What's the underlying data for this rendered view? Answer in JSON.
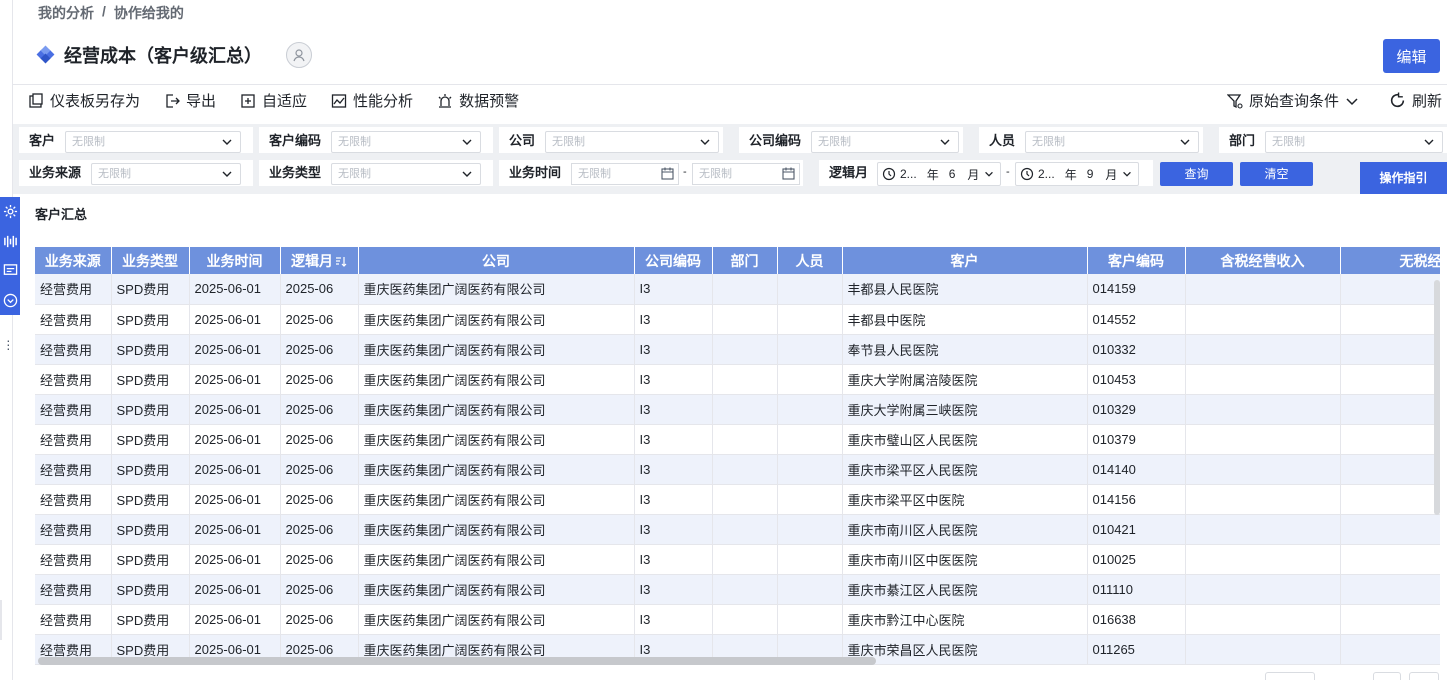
{
  "breadcrumb": {
    "home": "我的分析",
    "sep": "/",
    "current": "协作给我的"
  },
  "header": {
    "title": "经营成本（客户级汇总）",
    "edit_label": "编辑"
  },
  "toolbar": {
    "save_as": "仪表板另存为",
    "export": "导出",
    "adapt": "自适应",
    "perf": "性能分析",
    "alert": "数据预警",
    "orig_query": "原始查询条件",
    "refresh": "刷新"
  },
  "filters": {
    "placeholder": "无限制",
    "customer": "客户",
    "customer_code": "客户编码",
    "company": "公司",
    "company_code": "公司编码",
    "staff": "人员",
    "dept": "部门",
    "biz_source": "业务来源",
    "biz_type": "业务类型",
    "biz_time": "业务时间",
    "logic_month": "逻辑月",
    "dash": "-",
    "month_from": {
      "year": "2...",
      "year_unit": "年",
      "month": "6",
      "month_unit": "月"
    },
    "month_to": {
      "year": "2...",
      "year_unit": "年",
      "month": "9",
      "month_unit": "月"
    },
    "query": "查询",
    "clear": "清空",
    "op_guide": "操作指引"
  },
  "section": {
    "title": "客户汇总"
  },
  "table": {
    "columns": [
      "业务来源",
      "业务类型",
      "业务时间",
      "逻辑月",
      "公司",
      "公司编码",
      "部门",
      "人员",
      "客户",
      "客户编码",
      "含税经营收入",
      "无税经营"
    ],
    "rows": [
      [
        "经营费用",
        "SPD费用",
        "2025-06-01",
        "2025-06",
        "重庆医药集团广阔医药有限公司",
        "I3",
        "",
        "",
        "丰都县人民医院",
        "014159",
        "",
        ""
      ],
      [
        "经营费用",
        "SPD费用",
        "2025-06-01",
        "2025-06",
        "重庆医药集团广阔医药有限公司",
        "I3",
        "",
        "",
        "丰都县中医院",
        "014552",
        "",
        ""
      ],
      [
        "经营费用",
        "SPD费用",
        "2025-06-01",
        "2025-06",
        "重庆医药集团广阔医药有限公司",
        "I3",
        "",
        "",
        "奉节县人民医院",
        "010332",
        "",
        ""
      ],
      [
        "经营费用",
        "SPD费用",
        "2025-06-01",
        "2025-06",
        "重庆医药集团广阔医药有限公司",
        "I3",
        "",
        "",
        "重庆大学附属涪陵医院",
        "010453",
        "",
        ""
      ],
      [
        "经营费用",
        "SPD费用",
        "2025-06-01",
        "2025-06",
        "重庆医药集团广阔医药有限公司",
        "I3",
        "",
        "",
        "重庆大学附属三峡医院",
        "010329",
        "",
        ""
      ],
      [
        "经营费用",
        "SPD费用",
        "2025-06-01",
        "2025-06",
        "重庆医药集团广阔医药有限公司",
        "I3",
        "",
        "",
        "重庆市璧山区人民医院",
        "010379",
        "",
        ""
      ],
      [
        "经营费用",
        "SPD费用",
        "2025-06-01",
        "2025-06",
        "重庆医药集团广阔医药有限公司",
        "I3",
        "",
        "",
        "重庆市梁平区人民医院",
        "014140",
        "",
        ""
      ],
      [
        "经营费用",
        "SPD费用",
        "2025-06-01",
        "2025-06",
        "重庆医药集团广阔医药有限公司",
        "I3",
        "",
        "",
        "重庆市梁平区中医院",
        "014156",
        "",
        ""
      ],
      [
        "经营费用",
        "SPD费用",
        "2025-06-01",
        "2025-06",
        "重庆医药集团广阔医药有限公司",
        "I3",
        "",
        "",
        "重庆市南川区人民医院",
        "010421",
        "",
        ""
      ],
      [
        "经营费用",
        "SPD费用",
        "2025-06-01",
        "2025-06",
        "重庆医药集团广阔医药有限公司",
        "I3",
        "",
        "",
        "重庆市南川区中医医院",
        "010025",
        "",
        ""
      ],
      [
        "经营费用",
        "SPD费用",
        "2025-06-01",
        "2025-06",
        "重庆医药集团广阔医药有限公司",
        "I3",
        "",
        "",
        "重庆市綦江区人民医院",
        "011110",
        "",
        ""
      ],
      [
        "经营费用",
        "SPD费用",
        "2025-06-01",
        "2025-06",
        "重庆医药集团广阔医药有限公司",
        "I3",
        "",
        "",
        "重庆市黔江中心医院",
        "016638",
        "",
        ""
      ],
      [
        "经营费用",
        "SPD费用",
        "2025-06-01",
        "2025-06",
        "重庆医药集团广阔医药有限公司",
        "I3",
        "",
        "",
        "重庆市荣昌区人民医院",
        "011265",
        "",
        ""
      ]
    ]
  },
  "colors": {
    "accent": "#3b64e0",
    "header_bg": "#6e91dd",
    "row_alt": "#eef2fb"
  }
}
